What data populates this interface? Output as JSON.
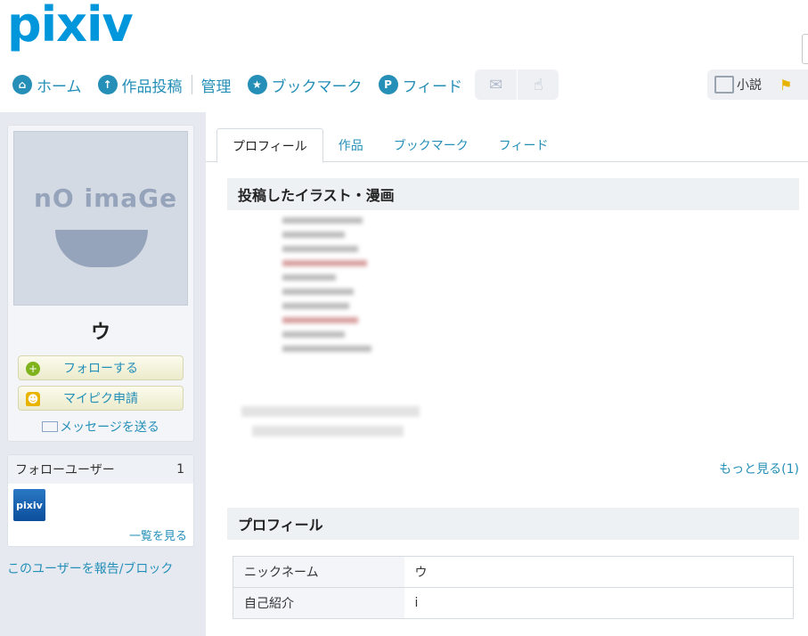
{
  "header": {
    "logo": "pixiv",
    "nav": [
      {
        "label": "ホーム",
        "icon": "home-icon"
      },
      {
        "label": "作品投稿",
        "icon": "upload-icon"
      },
      {
        "label": "管理",
        "icon": ""
      },
      {
        "label": "ブックマーク",
        "icon": "star-icon"
      },
      {
        "label": "フィード",
        "icon": "feed-icon"
      }
    ],
    "icon_buttons": [
      {
        "icon": "mail-icon"
      },
      {
        "icon": "notification-icon"
      }
    ],
    "right_nav": {
      "novel_label": "小説"
    }
  },
  "sidebar": {
    "username": "ウ",
    "follow_button": "フォローする",
    "mypixiv_button": "マイピク申請",
    "message_link": "メッセージを送る",
    "follow_users": {
      "title": "フォローユーザー",
      "count": "1",
      "avatar_text": "pixiv",
      "more_link": "一覧を見る"
    },
    "report_link": "このユーザーを報告/ブロック"
  },
  "main": {
    "tabs": [
      {
        "label": "プロフィール",
        "active": true
      },
      {
        "label": "作品",
        "active": false
      },
      {
        "label": "ブックマーク",
        "active": false
      },
      {
        "label": "フィード",
        "active": false
      }
    ],
    "works_section_title": "投稿したイラスト・漫画",
    "more_link": "もっと見る(1)",
    "profile_section_title": "プロフィール",
    "profile_rows": [
      {
        "key": "ニックネーム",
        "value": "ウ"
      },
      {
        "key": "自己紹介",
        "value": "i"
      }
    ]
  },
  "colors": {
    "accent": "#258fb8",
    "logo": "#0096db",
    "background": "#e6eaf0"
  }
}
